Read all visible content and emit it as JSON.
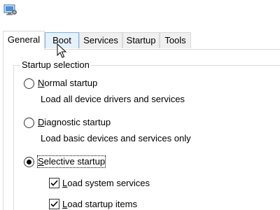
{
  "window": {
    "icon": "system-configuration-icon"
  },
  "tabs": [
    {
      "label": "General",
      "state": "selected"
    },
    {
      "label": "Boot",
      "state": "hover"
    },
    {
      "label": "Services",
      "state": "normal"
    },
    {
      "label": "Startup",
      "state": "normal"
    },
    {
      "label": "Tools",
      "state": "normal"
    }
  ],
  "startup_selection": {
    "group_label": "Startup selection",
    "options": [
      {
        "label_access": "N",
        "label_rest": "ormal startup",
        "description": "Load all device drivers and services",
        "selected": false
      },
      {
        "label_access": "D",
        "label_rest": "iagnostic startup",
        "description": "Load basic devices and services only",
        "selected": false
      },
      {
        "label_access": "S",
        "label_rest": "elective startup",
        "selected": true
      }
    ],
    "selective_items": [
      {
        "label_access": "L",
        "label_rest": "oad system services",
        "checked": true
      },
      {
        "label_access": "L",
        "label_rest": "oad startup items",
        "checked": true
      }
    ]
  },
  "colors": {
    "tab_hover": "#e5f1fb",
    "tab_border": "#d9d9d9",
    "tab_inactive": "#f0f0f0"
  }
}
